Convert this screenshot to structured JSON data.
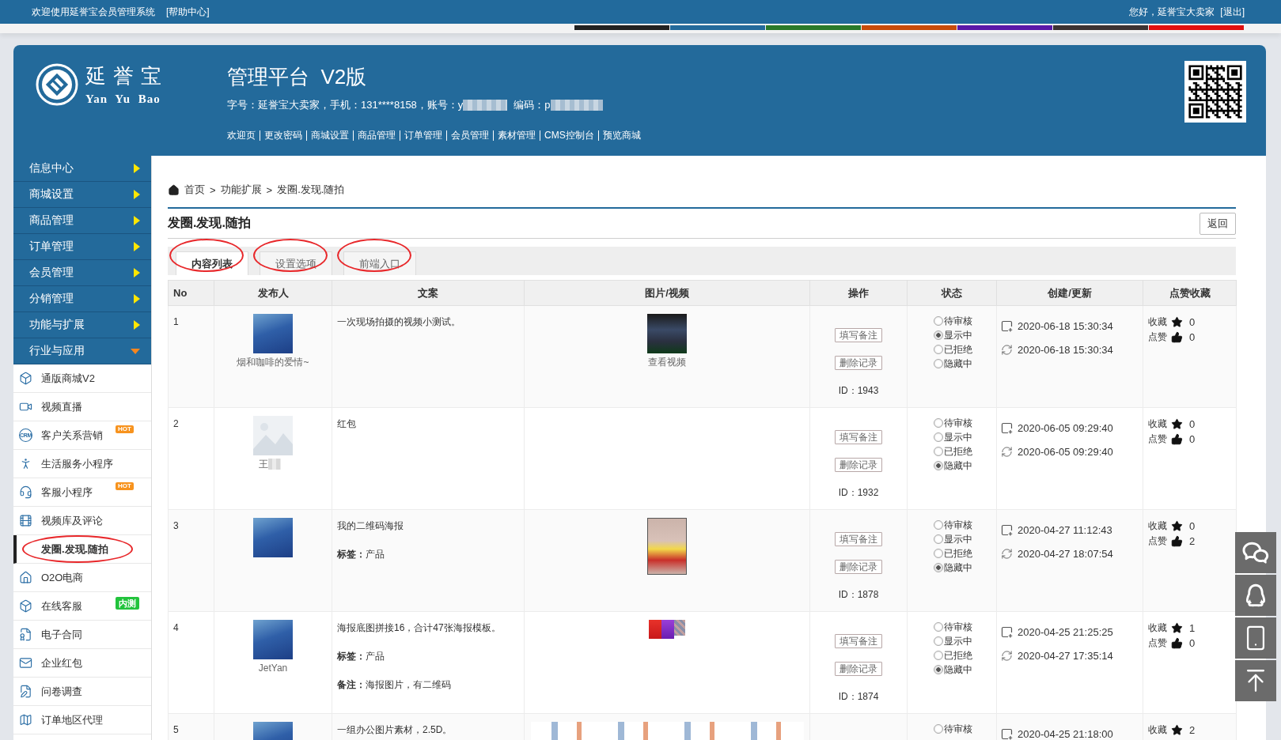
{
  "top_bar": {
    "welcome": "欢迎使用延誉宝会员管理系统",
    "help_link": "[帮助中心]",
    "greeting": "您好，延誉宝大卖家",
    "logout_link": "[退出]"
  },
  "skins": [
    {
      "color": "#222222"
    },
    {
      "color": "#236a9b"
    },
    {
      "color": "#2a7a2a"
    },
    {
      "color": "#c84b0a"
    },
    {
      "color": "#5a18a8"
    },
    {
      "color": "#3d3333"
    },
    {
      "color": "#e01010"
    }
  ],
  "header": {
    "logo": {
      "name": "延誉宝",
      "subtitle": "Yan Yu Bao"
    },
    "title": "管理平台  V2版",
    "account_info": [
      {
        "text": "字号：延誉宝大卖家，手机：131****8158，账号：y",
        "redacted": true
      },
      {
        "text": "编码：p",
        "redacted": true
      }
    ],
    "nav": [
      "欢迎页",
      "更改密码",
      "商城设置",
      "商品管理",
      "订单管理",
      "会员管理",
      "素材管理",
      "CMS控制台",
      "预览商城"
    ]
  },
  "sidebar": {
    "items": [
      {
        "label": "信息中心",
        "expanded": false
      },
      {
        "label": "商城设置",
        "expanded": false
      },
      {
        "label": "商品管理",
        "expanded": false
      },
      {
        "label": "订单管理",
        "expanded": false
      },
      {
        "label": "会员管理",
        "expanded": false
      },
      {
        "label": "分销管理",
        "expanded": false
      },
      {
        "label": "功能与扩展",
        "expanded": false
      },
      {
        "label": "行业与应用",
        "expanded": true,
        "children": [
          {
            "label": "通版商城V2",
            "selected": false,
            "circled": false
          },
          {
            "label": "视频直播",
            "selected": false,
            "circled": false
          },
          {
            "label": "客户关系营销",
            "icon_label": "CRM",
            "badge": {
              "kind": "flag",
              "text": "HOT",
              "color": "#f7931e"
            },
            "selected": false,
            "circled": false
          },
          {
            "label": "生活服务小程序",
            "selected": false,
            "circled": false
          },
          {
            "label": "客服小程序",
            "badge": {
              "kind": "flag",
              "text": "HOT",
              "color": "#f7931e"
            },
            "selected": false,
            "circled": false
          },
          {
            "label": "视频库及评论",
            "selected": false,
            "circled": false
          },
          {
            "label": "发圈.发现.随拍",
            "selected": true,
            "circled": true
          },
          {
            "label": "O2O电商",
            "selected": false,
            "circled": false
          },
          {
            "label": "在线客服",
            "badge": {
              "kind": "block",
              "text": "内测",
              "color": "#22c33c"
            },
            "selected": false,
            "circled": false
          },
          {
            "label": "电子合同",
            "selected": false,
            "circled": false
          },
          {
            "label": "企业红包",
            "selected": false,
            "circled": false
          },
          {
            "label": "问卷调查",
            "selected": false,
            "circled": false
          },
          {
            "label": "订单地区代理",
            "selected": false,
            "circled": false
          }
        ]
      }
    ]
  },
  "breadcrumb": [
    "首页",
    ">",
    "功能扩展",
    ">",
    "发圈.发现.随拍"
  ],
  "page": {
    "title": "发圈.发现.随拍",
    "back_button": "返回"
  },
  "tabs": [
    {
      "label": "内容列表",
      "selected": true,
      "circled": true
    },
    {
      "label": "设置选项",
      "selected": false,
      "circled": true
    },
    {
      "label": "前端入口",
      "selected": false,
      "circled": true
    }
  ],
  "table": {
    "columns": [
      "No",
      "发布人",
      "文案",
      "图片/视频",
      "操作",
      "状态",
      "创建/更新",
      "点赞收藏"
    ],
    "rows": [
      {
        "no": "1",
        "publisher": {
          "kind": "photo",
          "name": "烟和咖啡的爱情~"
        },
        "text": [
          "一次现场拍摄的视频小测试。"
        ],
        "media": {
          "kind": "video",
          "link": "查看视频"
        },
        "actions": [
          "填写备注",
          "删除记录"
        ],
        "id": "ID：1943",
        "status": [
          {
            "label": "待审核",
            "selected": false
          },
          {
            "label": "显示中",
            "selected": true
          },
          {
            "label": "已拒绝",
            "selected": false
          },
          {
            "label": "隐藏中",
            "selected": false
          }
        ],
        "times": [
          {
            "kind": "created",
            "text": "2020-06-18 15:30:34"
          },
          {
            "kind": "updated",
            "text": "2020-06-18 15:30:34"
          }
        ],
        "reactions": [
          {
            "kind": "favorite",
            "label": "收藏",
            "count": "0"
          },
          {
            "kind": "like",
            "label": "点赞",
            "count": "0"
          }
        ]
      },
      {
        "no": "2",
        "publisher": {
          "kind": "placeholder",
          "name": "王",
          "redacted": true
        },
        "text": [
          "红包"
        ],
        "actions": [
          "填写备注",
          "删除记录"
        ],
        "id": "ID：1932",
        "status": [
          {
            "label": "待审核",
            "selected": false
          },
          {
            "label": "显示中",
            "selected": false
          },
          {
            "label": "已拒绝",
            "selected": false
          },
          {
            "label": "隐藏中",
            "selected": true
          }
        ],
        "times": [
          {
            "kind": "created",
            "text": "2020-06-05 09:29:40"
          },
          {
            "kind": "updated",
            "text": "2020-06-05 09:29:40"
          }
        ],
        "reactions": [
          {
            "kind": "favorite",
            "label": "收藏",
            "count": "0"
          },
          {
            "kind": "like",
            "label": "点赞",
            "count": "0"
          }
        ]
      },
      {
        "no": "3",
        "publisher": {
          "kind": "photo"
        },
        "text": [
          "我的二维码海报",
          "**标签：**产品"
        ],
        "media": {
          "kind": "poster"
        },
        "actions": [
          "填写备注",
          "删除记录"
        ],
        "id": "ID：1878",
        "status": [
          {
            "label": "待审核",
            "selected": false
          },
          {
            "label": "显示中",
            "selected": false
          },
          {
            "label": "已拒绝",
            "selected": false
          },
          {
            "label": "隐藏中",
            "selected": true
          }
        ],
        "times": [
          {
            "kind": "created",
            "text": "2020-04-27 11:12:43"
          },
          {
            "kind": "updated",
            "text": "2020-04-27 18:07:54"
          }
        ],
        "reactions": [
          {
            "kind": "favorite",
            "label": "收藏",
            "count": "0"
          },
          {
            "kind": "like",
            "label": "点赞",
            "count": "2"
          }
        ]
      },
      {
        "no": "4",
        "publisher": {
          "kind": "photo",
          "name": "JetYan"
        },
        "text": [
          "海报底图拼接16，合计47张海报模板。",
          "**标签：**产品",
          "**备注：**海报图片，有二维码"
        ],
        "media": {
          "kind": "thumbnails"
        },
        "actions": [
          "填写备注",
          "删除记录"
        ],
        "id": "ID：1874",
        "status": [
          {
            "label": "待审核",
            "selected": false
          },
          {
            "label": "显示中",
            "selected": false
          },
          {
            "label": "已拒绝",
            "selected": false
          },
          {
            "label": "隐藏中",
            "selected": true
          }
        ],
        "times": [
          {
            "kind": "created",
            "text": "2020-04-25 21:25:25"
          },
          {
            "kind": "updated",
            "text": "2020-04-27 17:35:14"
          }
        ],
        "reactions": [
          {
            "kind": "favorite",
            "label": "收藏",
            "count": "1"
          },
          {
            "kind": "like",
            "label": "点赞",
            "count": "0"
          }
        ]
      },
      {
        "no": "5",
        "publisher": {
          "kind": "photo"
        },
        "text": [
          "一组办公图片素材，2.5D。"
        ],
        "media": {
          "kind": "strip"
        },
        "status": [
          {
            "label": "待审核",
            "selected": false
          }
        ],
        "times": [
          {
            "kind": "created",
            "text": "2020-04-25 21:18:00"
          }
        ],
        "reactions": [
          {
            "kind": "favorite",
            "label": "收藏",
            "count": "2"
          }
        ]
      }
    ]
  }
}
